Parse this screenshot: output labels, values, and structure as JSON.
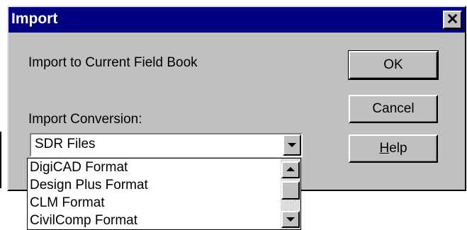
{
  "window": {
    "title": "Import",
    "close_glyph": "✕"
  },
  "main": {
    "target_label": "Import to Current Field Book",
    "conversion_label": "Import Conversion:",
    "conversion_select": {
      "selected": "SDR Files",
      "options": [
        "DigiCAD Format",
        "Design Plus Format",
        "CLM Format",
        "CivilComp Format"
      ]
    }
  },
  "buttons": {
    "ok": "OK",
    "cancel": "Cancel",
    "help_mnemonic": "H",
    "help_rest": "elp"
  },
  "colors": {
    "titlebar": "#000080",
    "face": "#c0c0c0"
  },
  "icons": {
    "close": "close-icon",
    "dropdown": "chevron-down-icon",
    "scroll_up": "scroll-up-icon",
    "scroll_down": "scroll-down-icon"
  }
}
